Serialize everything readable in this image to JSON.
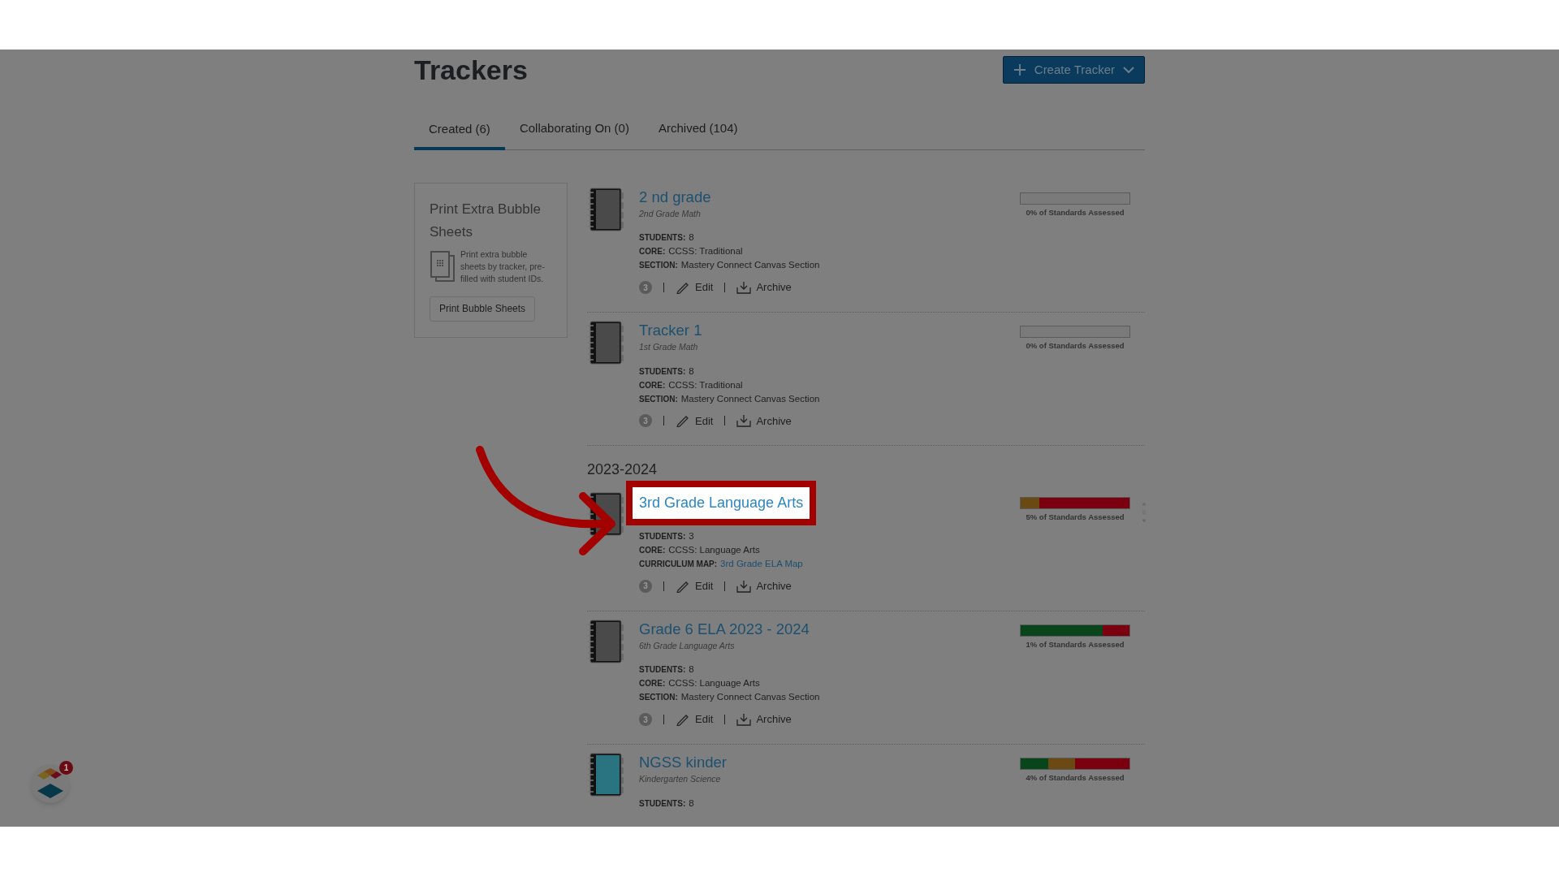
{
  "page": {
    "title": "Trackers"
  },
  "create_button": {
    "label": "Create Tracker"
  },
  "tabs": [
    {
      "label": "Created (6)",
      "selected": true
    },
    {
      "label": "Collaborating On (0)",
      "selected": false
    },
    {
      "label": "Archived (104)",
      "selected": false
    }
  ],
  "sidebar_card": {
    "title": "Print Extra Bubble Sheets",
    "description": "Print extra bubble sheets by tracker, pre-filled with student IDs.",
    "button": "Print Bubble Sheets"
  },
  "groups": [
    {
      "trackers": [
        {
          "title": "2 nd grade",
          "subtitle": "2nd Grade Math",
          "color": "#4a4a4a",
          "highlighted": false,
          "details": [
            {
              "label": "STUDENTS:",
              "value": "8",
              "kind": "text"
            },
            {
              "label": "CORE:",
              "value": "CCSS: Traditional",
              "kind": "text"
            },
            {
              "label": "SECTION:",
              "value": "Mastery Connect Canvas Section",
              "kind": "text"
            }
          ],
          "count": "3",
          "actions": [
            "Edit",
            "Archive"
          ],
          "progress_caption": "0% of Standards Assessed"
        },
        {
          "title": "Tracker 1",
          "subtitle": "1st Grade Math",
          "color": "#4a4a4a",
          "highlighted": false,
          "details": [
            {
              "label": "STUDENTS:",
              "value": "8",
              "kind": "text"
            },
            {
              "label": "CORE:",
              "value": "CCSS: Traditional",
              "kind": "text"
            },
            {
              "label": "SECTION:",
              "value": "Mastery Connect Canvas Section",
              "kind": "text"
            }
          ],
          "count": "3",
          "actions": [
            "Edit",
            "Archive"
          ],
          "progress_caption": "0% of Standards Assessed"
        }
      ]
    },
    {
      "heading": "2023-2024",
      "trackers": [
        {
          "title": "3rd Grade Language Arts",
          "color": "#4a4a4a",
          "highlighted": true,
          "reorder_handle": true,
          "details": [
            {
              "label": "STUDENTS:",
              "value": "3",
              "kind": "text"
            },
            {
              "label": "CORE:",
              "value": "CCSS: Language Arts",
              "kind": "text"
            },
            {
              "label": "CURRICULUM MAP:",
              "value": "3rd Grade ELA Map",
              "kind": "link"
            }
          ],
          "count": "3",
          "actions": [
            "Edit",
            "Archive"
          ],
          "progress_caption": "5% of Standards Assessed",
          "progress": {
            "color": "#7a0010",
            "segments": [
              {
                "color": "#6a4a12",
                "level": 0.17
              }
            ]
          }
        },
        {
          "title": "Grade 6 ELA 2023 - 2024",
          "subtitle": "6th Grade Language Arts",
          "color": "#4a4a4a",
          "highlighted": false,
          "details": [
            {
              "label": "STUDENTS:",
              "value": "8",
              "kind": "text"
            },
            {
              "label": "CORE:",
              "value": "CCSS: Language Arts",
              "kind": "text"
            },
            {
              "label": "SECTION:",
              "value": "Mastery Connect Canvas Section",
              "kind": "text"
            }
          ],
          "count": "3",
          "actions": [
            "Edit",
            "Archive"
          ],
          "progress_caption": "1% of Standards Assessed",
          "progress": {
            "color": "#7a0010",
            "segments": [
              {
                "color": "#08451a",
                "level": 0.75
              }
            ]
          }
        },
        {
          "title": "NGSS kinder",
          "subtitle": "Kindergarten Science",
          "color": "#2a7380",
          "highlighted": false,
          "details": [
            {
              "label": "STUDENTS:",
              "value": "8",
              "kind": "text"
            }
          ],
          "progress_caption": "4% of Standards Assessed",
          "progress": {
            "color": "#7a0010",
            "segments": [
              {
                "color": "#08451a",
                "level": 0.25
              },
              {
                "color": "#6a4a12",
                "level": 0.5
              }
            ]
          }
        }
      ]
    }
  ],
  "launcher": {
    "badge": "1"
  }
}
